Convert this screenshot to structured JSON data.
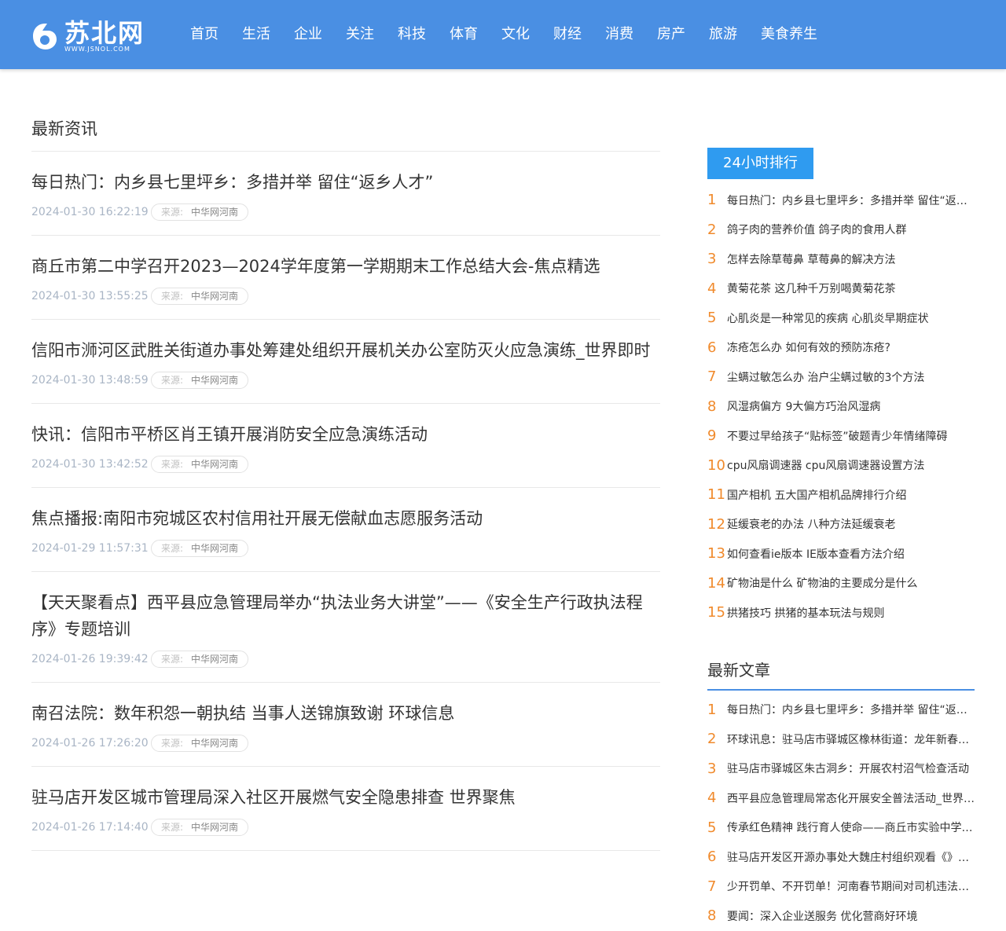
{
  "logo": {
    "name": "苏北网",
    "domain": "WWW.JSNOL.COM"
  },
  "nav": [
    "首页",
    "生活",
    "企业",
    "关注",
    "科技",
    "体育",
    "文化",
    "财经",
    "消费",
    "房产",
    "旅游",
    "美食养生"
  ],
  "main": {
    "section_title": "最新资讯",
    "source_label": "来源:",
    "articles": [
      {
        "title": "每日热门：内乡县七里坪乡：多措并举 留住“返乡人才”",
        "date": "2024-01-30 16:22:19",
        "source": "中华网河南"
      },
      {
        "title": "商丘市第二中学召开2023—2024学年度第一学期期末工作总结大会-焦点精选",
        "date": "2024-01-30 13:55:25",
        "source": "中华网河南"
      },
      {
        "title": "信阳市浉河区武胜关街道办事处筹建处组织开展机关办公室防灭火应急演练_世界即时",
        "date": "2024-01-30 13:48:59",
        "source": "中华网河南"
      },
      {
        "title": "快讯：信阳市平桥区肖王镇开展消防安全应急演练活动",
        "date": "2024-01-30 13:42:52",
        "source": "中华网河南"
      },
      {
        "title": "焦点播报:南阳市宛城区农村信用社开展无偿献血志愿服务活动",
        "date": "2024-01-29 11:57:31",
        "source": "中华网河南"
      },
      {
        "title": "【天天聚看点】西平县应急管理局举办“执法业务大讲堂”——《安全生产行政执法程序》专题培训",
        "date": "2024-01-26 19:39:42",
        "source": "中华网河南"
      },
      {
        "title": "南召法院：数年积怨一朝执结 当事人送锦旗致谢 环球信息",
        "date": "2024-01-26 17:26:20",
        "source": "中华网河南"
      },
      {
        "title": "驻马店开发区城市管理局深入社区开展燃气安全隐患排查 世界聚焦",
        "date": "2024-01-26 17:14:40",
        "source": "中华网河南"
      }
    ]
  },
  "sidebar": {
    "rank_tab": "24小时排行",
    "rank": [
      "每日热门：内乡县七里坪乡：多措并举 留住“返乡人才”",
      "鸽子肉的营养价值 鸽子肉的食用人群",
      "怎样去除草莓鼻 草莓鼻的解决方法",
      "黄菊花茶 这几种千万别喝黄菊花茶",
      "心肌炎是一种常见的疾病 心肌炎早期症状",
      "冻疮怎么办 如何有效的预防冻疮?",
      "尘螨过敏怎么办 治户尘螨过敏的3个方法",
      "风湿病偏方 9大偏方巧治风湿病",
      "不要过早给孩子“贴标签”破题青少年情绪障碍",
      "cpu风扇调速器 cpu风扇调速器设置方法",
      "国产相机 五大国产相机品牌排行介绍",
      "延缓衰老的办法 八种方法延缓衰老",
      "如何查看ie版本 IE版本查看方法介绍",
      "矿物油是什么 矿物油的主要成分是什么",
      "拱猪技巧 拱猪的基本玩法与规则"
    ],
    "latest_title": "最新文章",
    "latest": [
      "每日热门：内乡县七里坪乡：多措并举 留住“返乡人才”",
      "环球讯息：驻马店市驿城区橡林街道：龙年新春送福送温暖",
      "驻马店市驿城区朱古洞乡：开展农村沼气检查活动",
      "西平县应急管理局常态化开展安全普法活动_世界热闻",
      "传承红色精神 践行育人使命——商丘市实验中学开展活动",
      "驻马店开发区开源办事处大魏庄村组织观看《》警示教育",
      "少开罚单、不开罚单！河南春节期间对司机违法行为",
      "要闻：深入企业送服务 优化营商好环境"
    ]
  }
}
